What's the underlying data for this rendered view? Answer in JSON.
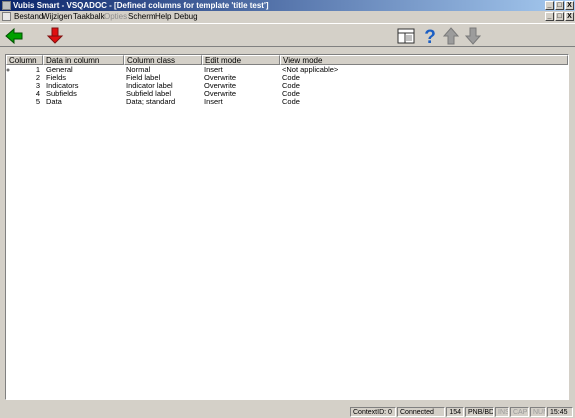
{
  "window": {
    "title": "Vubis Smart - VSQADOC - [Defined columns for template 'title test']",
    "controls": [
      "_",
      "□",
      "X"
    ],
    "mdi_controls": [
      "_",
      "□",
      "X"
    ]
  },
  "menu": {
    "items": [
      {
        "label": "Bestand",
        "enabled": true
      },
      {
        "label": "Wijzigen",
        "enabled": true
      },
      {
        "label": "Taakbalk",
        "enabled": true
      },
      {
        "label": "Opties",
        "enabled": false
      },
      {
        "label": "Scherm",
        "enabled": true
      },
      {
        "label": "Help",
        "enabled": true
      },
      {
        "label": "Debug",
        "enabled": true
      }
    ]
  },
  "toolbar": {
    "icons": [
      "back-arrow-icon",
      "download-arrow-icon",
      "layout-icon",
      "help-question-icon",
      "move-up-icon",
      "move-down-icon"
    ],
    "colors": {
      "back": "#00a000",
      "download": "#e01010",
      "help": "#1c5fc4",
      "disabled_arrow": "#9c9c9c"
    }
  },
  "table": {
    "headers": [
      "Column",
      "Data in column",
      "Column class",
      "Edit mode",
      "View mode"
    ],
    "rows": [
      {
        "num": "1",
        "data": "General",
        "class": "Normal",
        "edit": "Insert",
        "view": "<Not applicable>"
      },
      {
        "num": "2",
        "data": "Fields",
        "class": "Field label",
        "edit": "Overwrite",
        "view": "Code"
      },
      {
        "num": "3",
        "data": "Indicators",
        "class": "Indicator label",
        "edit": "Overwrite",
        "view": "Code"
      },
      {
        "num": "4",
        "data": "Subfields",
        "class": "Subfield label",
        "edit": "Overwrite",
        "view": "Code"
      },
      {
        "num": "5",
        "data": "Data",
        "class": "Data; standard",
        "edit": "Insert",
        "view": "Code"
      }
    ]
  },
  "statusbar": {
    "context": "ContextID: 0",
    "connection": "Connected",
    "number": "154",
    "db": "PNB/BD",
    "ins": "INS",
    "caps": "CAPS",
    "num": "NUM",
    "time": "15:45"
  }
}
